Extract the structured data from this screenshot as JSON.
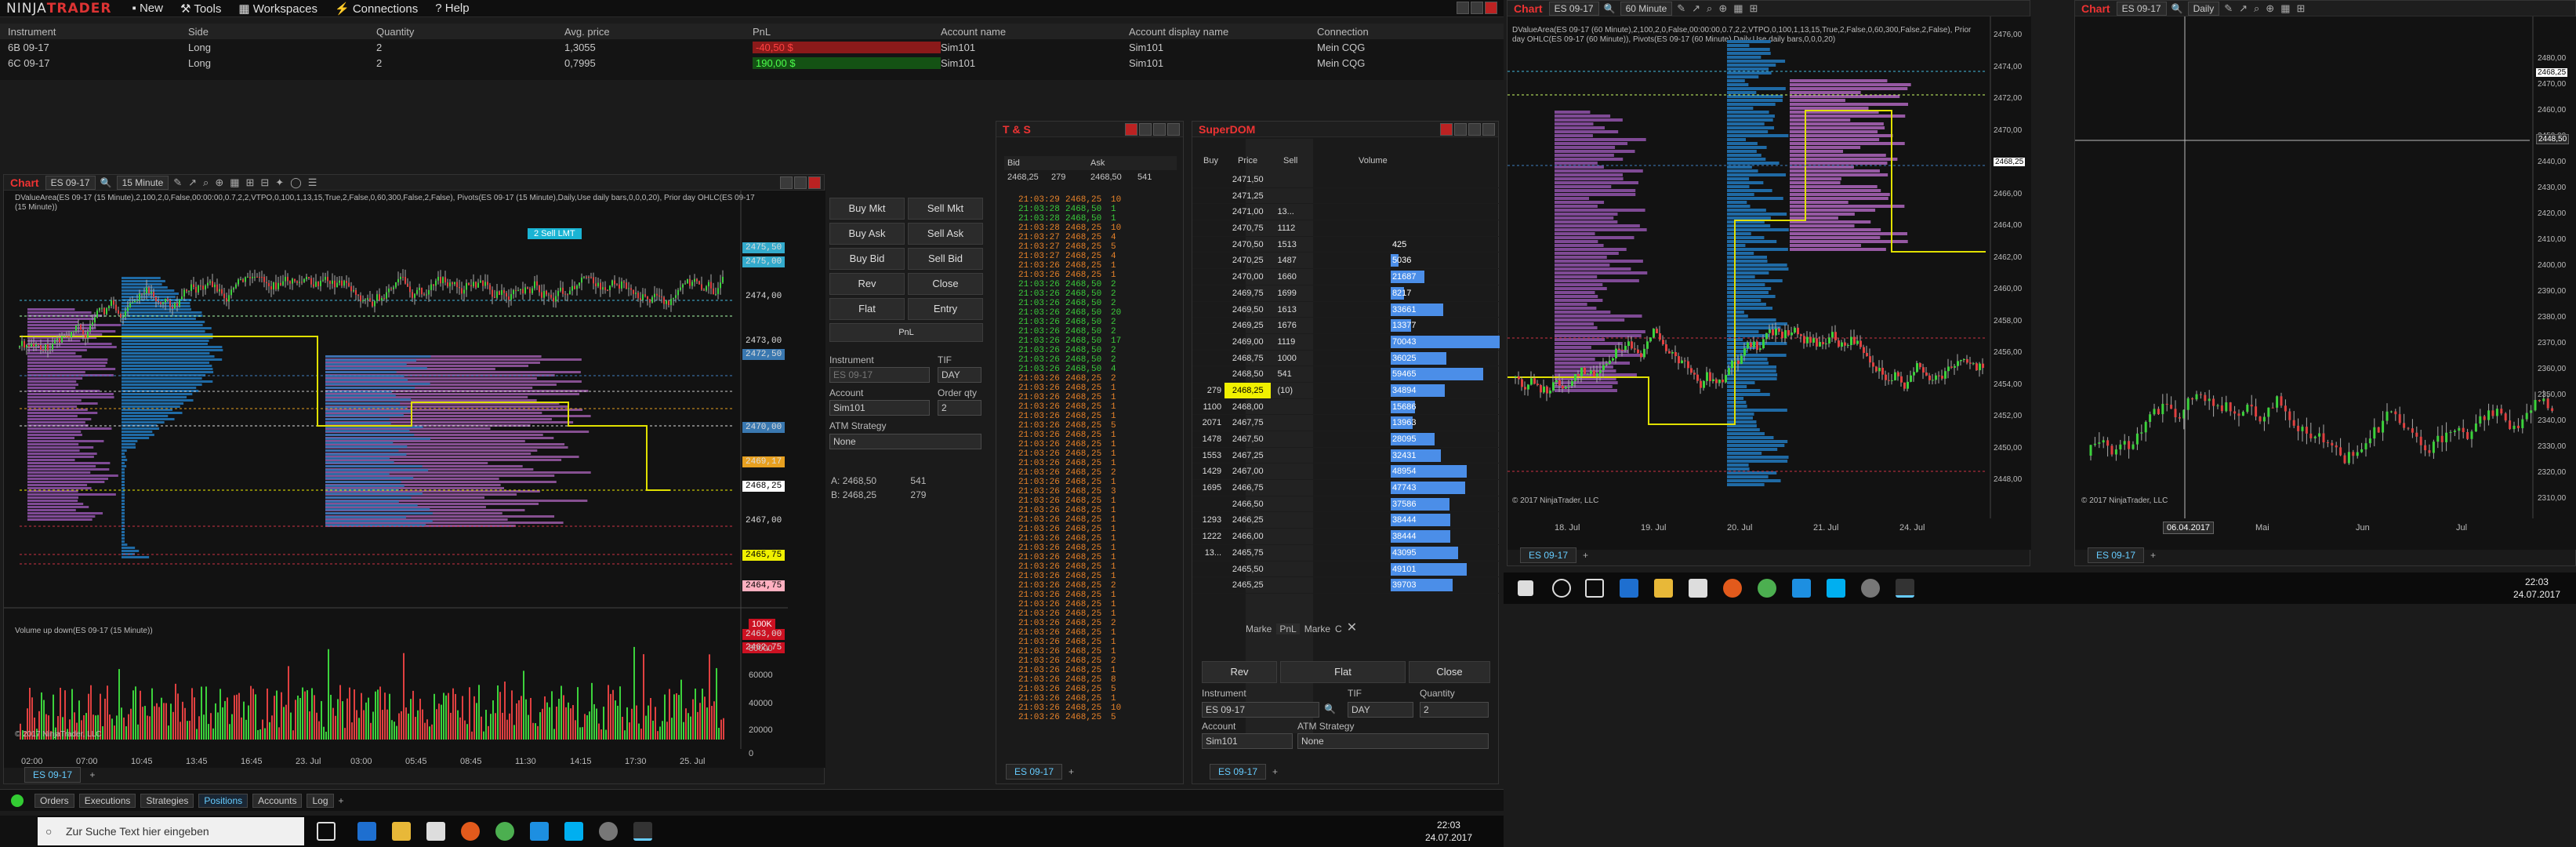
{
  "app": {
    "logo_pre": "NINJA",
    "logo_post": "TRADER"
  },
  "menu": [
    "New",
    "Tools",
    "Workspaces",
    "Connections",
    "Help"
  ],
  "positions": {
    "headers": [
      "Instrument",
      "Side",
      "Quantity",
      "Avg. price",
      "PnL",
      "Account name",
      "Account display name",
      "Connection"
    ],
    "rows": [
      [
        "6B 09-17",
        "Long",
        "2",
        "1,3055",
        "-40,50 $",
        "Sim101",
        "Sim101",
        "Mein CQG"
      ],
      [
        "6C 09-17",
        "Long",
        "2",
        "0,7995",
        "190,00 $",
        "Sim101",
        "Sim101",
        "Mein CQG"
      ]
    ],
    "pnl_colors": [
      "#e03030",
      "#3cd23c"
    ]
  },
  "chart1": {
    "title": "Chart",
    "instrument": "ES 09-17",
    "interval": "15 Minute",
    "indicator_text": "DValueArea(ES 09-17 (15 Minute),2,100,2,0,False,00:00:00,0.7,2,2,VTPO,0,100,1,13,15,True,2,False,0,60,300,False,2,False), Pivots(ES 09-17 (15 Minute),Daily,Use daily bars,0,0,0,20), Prior day OHLC(ES 09-17 (15 Minute))",
    "volume_text": "Volume up down(ES 09-17 (15 Minute))",
    "copyright": "© 2017 NinjaTrader, LLC",
    "order_label": "2  Sell LMT",
    "price_labels": [
      "2475,50",
      "2475,00",
      "2474,00",
      "2473,00",
      "2472,50",
      "2470,00",
      "2469,17",
      "2468,25",
      "2467,00",
      "2465,75",
      "2464,75",
      "2463,00",
      "2462,75"
    ],
    "price_label_colors": [
      "#33aacc",
      "#33aacc",
      "#121212",
      "#121212",
      "#3a78b0",
      "#3a78b0",
      "#e7a020",
      "#ffffff",
      "#121212",
      "#f0f000",
      "#ffb0c0",
      "#cc1122",
      "#cc1122"
    ],
    "volume_labels": [
      "100K",
      "80000",
      "60000",
      "40000",
      "20000",
      "0"
    ],
    "time_labels": [
      "02:00",
      "07:00",
      "10:45",
      "13:45",
      "16:45",
      "23. Jul",
      "03:00",
      "05:45",
      "08:45",
      "11:30",
      "14:15",
      "17:30",
      "25. Jul"
    ],
    "tab": "ES 09-17"
  },
  "order_panel": {
    "buy_mkt": "Buy Mkt",
    "sell_mkt": "Sell Mkt",
    "buy_ask": "Buy Ask",
    "sell_ask": "Sell Ask",
    "buy_bid": "Buy Bid",
    "sell_bid": "Sell Bid",
    "rev": "Rev",
    "close": "Close",
    "flat": "Flat",
    "entry": "Entry",
    "pnl": "PnL",
    "instrument_label": "Instrument",
    "instrument": "ES 09-17",
    "tif_label": "TIF",
    "tif": "DAY",
    "account_label": "Account",
    "account": "Sim101",
    "qty_label": "Order qty",
    "qty": "2",
    "atm_label": "ATM Strategy",
    "atm": "None",
    "ask_label": "A:",
    "ask_price": "2468,50",
    "ask_size": "541",
    "bid_label": "B:",
    "bid_price": "2468,25",
    "bid_size": "279"
  },
  "ts": {
    "title": "T & S",
    "col_bid": "Bid",
    "col_ask": "Ask",
    "bid": "2468,25",
    "bid_size": "279",
    "ask": "2468,50",
    "ask_size": "541",
    "rows": [
      [
        "21:03:29",
        "2468,25",
        "10",
        "o"
      ],
      [
        "21:03:28",
        "2468,50",
        "1",
        "g"
      ],
      [
        "21:03:28",
        "2468,50",
        "1",
        "g"
      ],
      [
        "21:03:28",
        "2468,25",
        "10",
        "o"
      ],
      [
        "21:03:27",
        "2468,25",
        "4",
        "o"
      ],
      [
        "21:03:27",
        "2468,25",
        "5",
        "o"
      ],
      [
        "21:03:27",
        "2468,25",
        "4",
        "o"
      ],
      [
        "21:03:26",
        "2468,25",
        "1",
        "o"
      ],
      [
        "21:03:26",
        "2468,25",
        "1",
        "o"
      ],
      [
        "21:03:26",
        "2468,50",
        "2",
        "g"
      ],
      [
        "21:03:26",
        "2468,50",
        "2",
        "g"
      ],
      [
        "21:03:26",
        "2468,50",
        "2",
        "g"
      ],
      [
        "21:03:26",
        "2468,50",
        "20",
        "g"
      ],
      [
        "21:03:26",
        "2468,50",
        "2",
        "g"
      ],
      [
        "21:03:26",
        "2468,50",
        "2",
        "g"
      ],
      [
        "21:03:26",
        "2468,50",
        "17",
        "g"
      ],
      [
        "21:03:26",
        "2468,50",
        "2",
        "g"
      ],
      [
        "21:03:26",
        "2468,50",
        "2",
        "g"
      ],
      [
        "21:03:26",
        "2468,50",
        "4",
        "g"
      ],
      [
        "21:03:26",
        "2468,25",
        "2",
        "o"
      ],
      [
        "21:03:26",
        "2468,25",
        "1",
        "o"
      ],
      [
        "21:03:26",
        "2468,25",
        "1",
        "o"
      ],
      [
        "21:03:26",
        "2468,25",
        "1",
        "o"
      ],
      [
        "21:03:26",
        "2468,25",
        "1",
        "o"
      ],
      [
        "21:03:26",
        "2468,25",
        "5",
        "o"
      ],
      [
        "21:03:26",
        "2468,25",
        "1",
        "o"
      ],
      [
        "21:03:26",
        "2468,25",
        "1",
        "o"
      ],
      [
        "21:03:26",
        "2468,25",
        "1",
        "o"
      ],
      [
        "21:03:26",
        "2468,25",
        "1",
        "o"
      ],
      [
        "21:03:26",
        "2468,25",
        "2",
        "o"
      ],
      [
        "21:03:26",
        "2468,25",
        "1",
        "o"
      ],
      [
        "21:03:26",
        "2468,25",
        "3",
        "o"
      ],
      [
        "21:03:26",
        "2468,25",
        "1",
        "o"
      ],
      [
        "21:03:26",
        "2468,25",
        "1",
        "o"
      ],
      [
        "21:03:26",
        "2468,25",
        "1",
        "o"
      ],
      [
        "21:03:26",
        "2468,25",
        "1",
        "o"
      ],
      [
        "21:03:26",
        "2468,25",
        "1",
        "o"
      ],
      [
        "21:03:26",
        "2468,25",
        "1",
        "o"
      ],
      [
        "21:03:26",
        "2468,25",
        "1",
        "o"
      ],
      [
        "21:03:26",
        "2468,25",
        "1",
        "o"
      ],
      [
        "21:03:26",
        "2468,25",
        "1",
        "o"
      ],
      [
        "21:03:26",
        "2468,25",
        "2",
        "o"
      ],
      [
        "21:03:26",
        "2468,25",
        "1",
        "o"
      ],
      [
        "21:03:26",
        "2468,25",
        "1",
        "o"
      ],
      [
        "21:03:26",
        "2468,25",
        "1",
        "o"
      ],
      [
        "21:03:26",
        "2468,25",
        "2",
        "o"
      ],
      [
        "21:03:26",
        "2468,25",
        "1",
        "o"
      ],
      [
        "21:03:26",
        "2468,25",
        "1",
        "o"
      ],
      [
        "21:03:26",
        "2468,25",
        "1",
        "o"
      ],
      [
        "21:03:26",
        "2468,25",
        "2",
        "o"
      ],
      [
        "21:03:26",
        "2468,25",
        "1",
        "o"
      ],
      [
        "21:03:26",
        "2468,25",
        "8",
        "o"
      ],
      [
        "21:03:26",
        "2468,25",
        "5",
        "o"
      ],
      [
        "21:03:26",
        "2468,25",
        "1",
        "o"
      ],
      [
        "21:03:26",
        "2468,25",
        "10",
        "o"
      ],
      [
        "21:03:26",
        "2468,25",
        "5",
        "o"
      ]
    ],
    "tab": "ES 09-17"
  },
  "superdom": {
    "title": "SuperDOM",
    "col_buy": "Buy",
    "col_price": "Price",
    "col_sell": "Sell",
    "col_volume": "Volume",
    "rows": [
      [
        "",
        "2471,50",
        "",
        ""
      ],
      [
        "",
        "2471,25",
        "",
        ""
      ],
      [
        "",
        "2471,00",
        "13...",
        ""
      ],
      [
        "",
        "2470,75",
        "1112",
        ""
      ],
      [
        "",
        "2470,50",
        "1513",
        "425"
      ],
      [
        "",
        "2470,25",
        "1487",
        "5036"
      ],
      [
        "",
        "2470,00",
        "1660",
        "21687"
      ],
      [
        "",
        "2469,75",
        "1699",
        "8217"
      ],
      [
        "",
        "2469,50",
        "1613",
        "33661"
      ],
      [
        "",
        "2469,25",
        "1676",
        "13377"
      ],
      [
        "",
        "2469,00",
        "1119",
        "70043"
      ],
      [
        "",
        "2468,75",
        "1000",
        "36025"
      ],
      [
        "",
        "2468,50",
        "541",
        "59465"
      ],
      [
        "279",
        "2468,25",
        "(10)",
        "34894"
      ],
      [
        "1100",
        "2468,00",
        "",
        "15686"
      ],
      [
        "2071",
        "2467,75",
        "",
        "13963"
      ],
      [
        "1478",
        "2467,50",
        "",
        "28095"
      ],
      [
        "1553",
        "2467,25",
        "",
        "32431"
      ],
      [
        "1429",
        "2467,00",
        "",
        "48954"
      ],
      [
        "1695",
        "2466,75",
        "",
        "47743"
      ],
      [
        "",
        "2466,50",
        "",
        "37586"
      ],
      [
        "1293",
        "2466,25",
        "",
        "38444"
      ],
      [
        "1222",
        "2466,00",
        "",
        "38444"
      ],
      [
        "13...",
        "2465,75",
        "",
        "43095"
      ],
      [
        "",
        "2465,50",
        "",
        "49101"
      ],
      [
        "",
        "2465,25",
        "",
        "39703"
      ]
    ],
    "volume_fill": [
      0.0,
      0.0,
      0.0,
      0.0,
      0.0,
      0.07,
      0.31,
      0.12,
      0.48,
      0.19,
      1.0,
      0.51,
      0.85,
      0.5,
      0.22,
      0.2,
      0.4,
      0.46,
      0.7,
      0.68,
      0.54,
      0.55,
      0.55,
      0.62,
      0.7,
      0.57
    ],
    "markers": {
      "m1": "Marke",
      "m2": "PnL",
      "m3": "Marke",
      "m4": "C"
    },
    "rev": "Rev",
    "flat": "Flat",
    "close": "Close",
    "instrument_label": "Instrument",
    "instrument": "ES 09-17",
    "tif_label": "TIF",
    "tif": "DAY",
    "qty_label": "Quantity",
    "qty": "2",
    "account_label": "Account",
    "account": "Sim101",
    "atm_label": "ATM Strategy",
    "atm": "None",
    "tab": "ES 09-17"
  },
  "chart2": {
    "title": "Chart",
    "instrument": "ES 09-17",
    "interval": "60 Minute",
    "indicator_text": "DValueArea(ES 09-17 (60 Minute),2,100,2,0,False,00:00:00,0.7,2,2,VTPO,0,100,1,13,15,True,2,False,0,60,300,False,2,False), Prior day OHLC(ES 09-17 (60 Minute)), Pivots(ES 09-17 (60 Minute),Daily,Use daily bars,0,0,0,20)",
    "copyright": "© 2017 NinjaTrader, LLC",
    "price_labels": [
      "2476,00",
      "2474,00",
      "2472,00",
      "2470,00",
      "2468,25",
      "2466,00",
      "2464,00",
      "2462,00",
      "2460,00",
      "2458,00",
      "2456,00",
      "2454,00",
      "2452,00",
      "2450,00",
      "2448,00"
    ],
    "time_labels": [
      "18. Jul",
      "19. Jul",
      "20. Jul",
      "21. Jul",
      "24. Jul"
    ],
    "tab": "ES 09-17"
  },
  "chart3": {
    "title": "Chart",
    "instrument": "ES 09-17",
    "interval": "Daily",
    "copyright": "© 2017 NinjaTrader, LLC",
    "price_labels": [
      "2480,00",
      "2470,00",
      "2460,00",
      "2450,00",
      "2440,00",
      "2430,00",
      "2420,00",
      "2410,00",
      "2400,00",
      "2390,00",
      "2380,00",
      "2370,00",
      "2360,00",
      "2350,00",
      "2340,00",
      "2330,00",
      "2320,00",
      "2310,00"
    ],
    "current": "2468,25",
    "crosshair_price": "2448,50",
    "crosshair_date": "06.04.2017",
    "time_labels": [
      "Mai",
      "Jun",
      "Jul"
    ],
    "tab": "ES 09-17"
  },
  "status_tabs": [
    "Orders",
    "Executions",
    "Strategies",
    "Positions",
    "Accounts",
    "Log"
  ],
  "taskbar": {
    "search": "Zur Suche Text hier eingeben",
    "time": "22:03",
    "date": "24.07.2017"
  },
  "taskbar2": {
    "time": "22:03",
    "date": "24.07.2017"
  }
}
